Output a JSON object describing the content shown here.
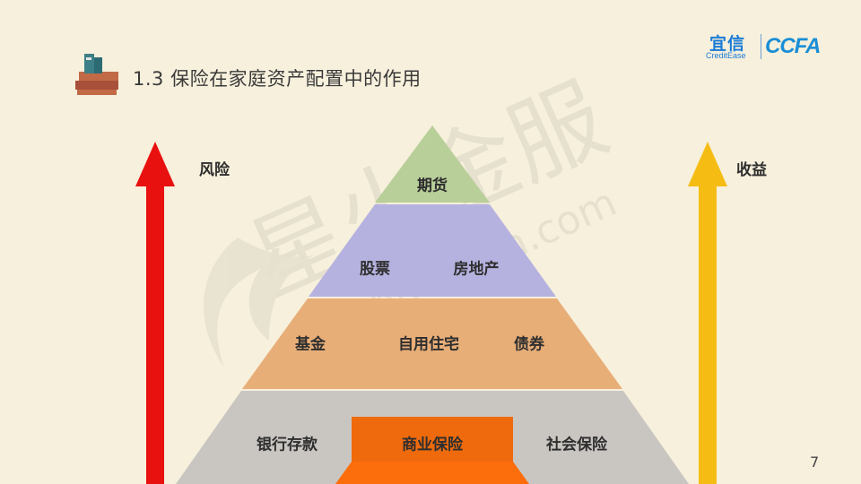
{
  "title": "1.3 保险在家庭资产配置中的作用",
  "logo": {
    "cn": "宜信",
    "en": "CreditEase",
    "ccfa": "CCFA"
  },
  "watermark": {
    "cn": "星火金服",
    "en": "xinghuoyixin.com"
  },
  "left_arrow": {
    "label": "风险",
    "color": "#e8110f"
  },
  "right_arrow": {
    "label": "收益",
    "color": "#f5bd14"
  },
  "pyramid": {
    "tier1": {
      "items": [
        "期货"
      ],
      "color": "#b9cf9a"
    },
    "tier2": {
      "items": [
        "股票",
        "房地产"
      ],
      "color": "#b6b2e0"
    },
    "tier3": {
      "items": [
        "基金",
        "自用住宅",
        "债券"
      ],
      "color": "#e8ae78"
    },
    "tier4": {
      "items": [
        "银行存款",
        "商业保险",
        "社会保险"
      ],
      "color": "#c9c6c2",
      "highlight_color": "#ee6a0c"
    }
  },
  "page_number": "7"
}
